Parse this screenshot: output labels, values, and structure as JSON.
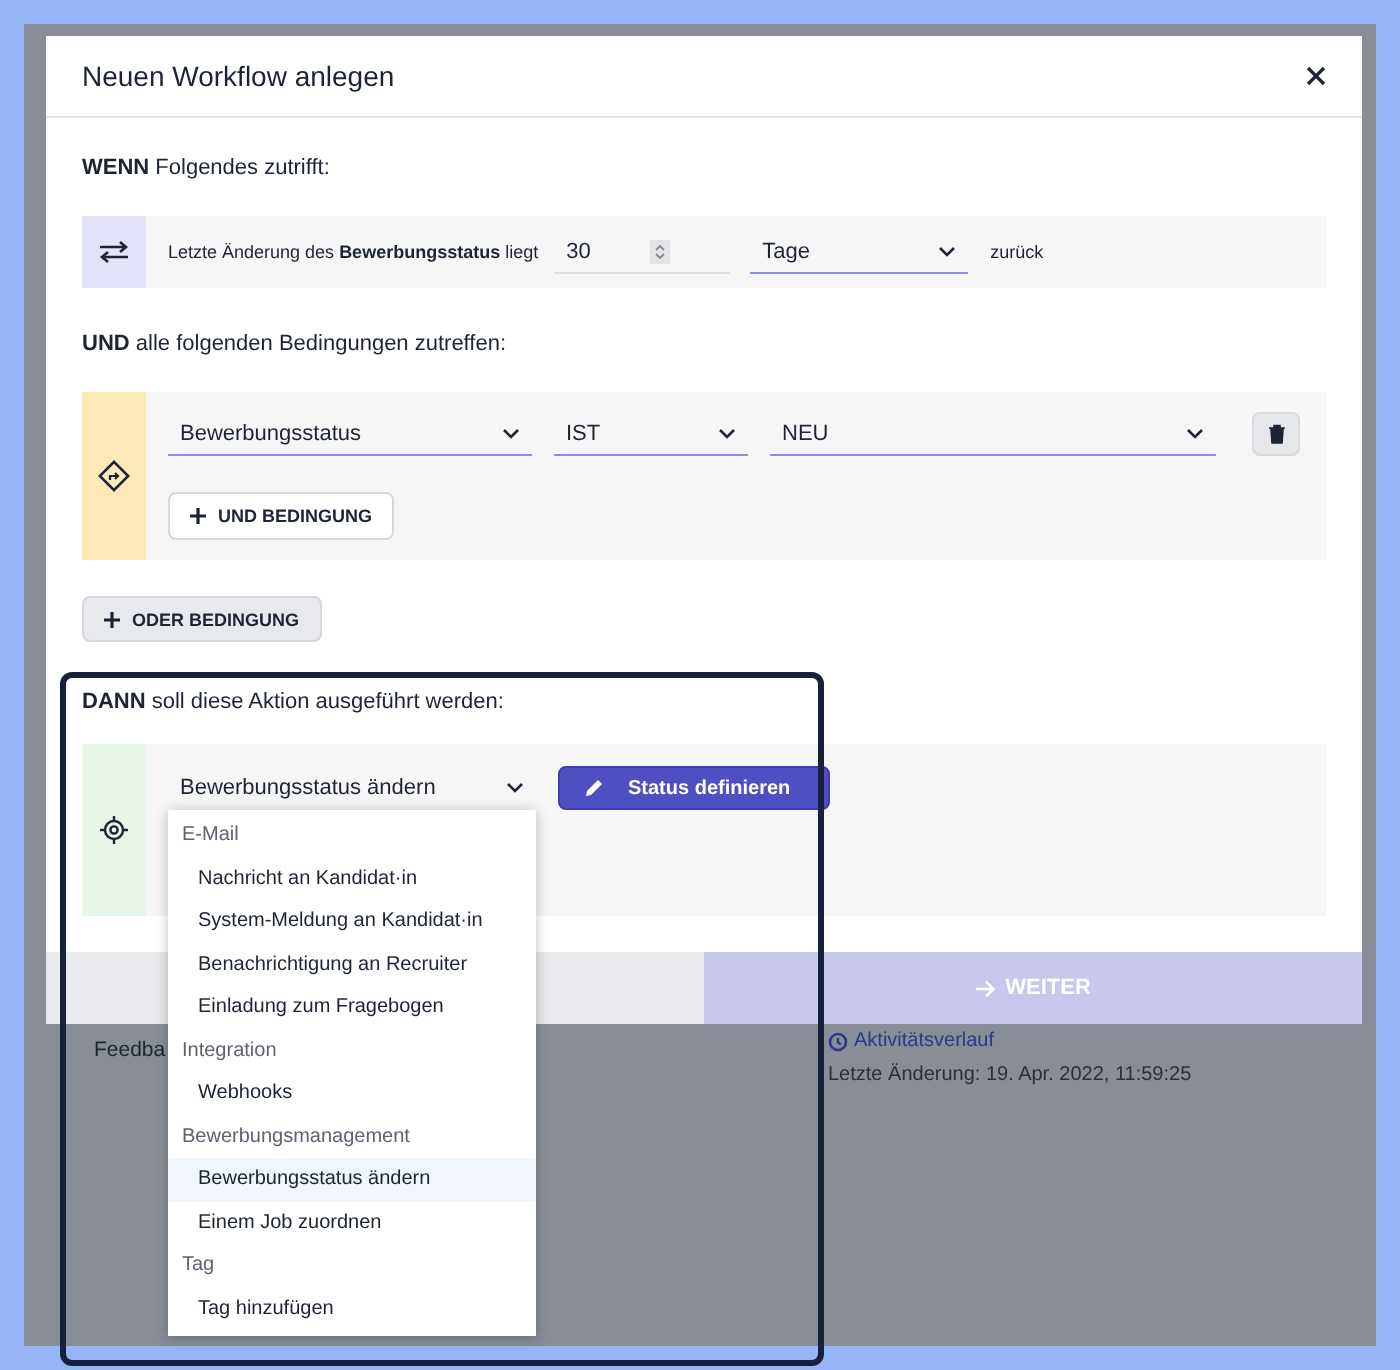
{
  "dialog": {
    "title": "Neuen Workflow anlegen"
  },
  "trigger": {
    "heading": "**WENN** Folgendes zutrifft:",
    "text": "Letzte Änderung des **Bewerbungsstatus** liegt",
    "amount": "30",
    "unit": "Tage",
    "suffix": "zurück"
  },
  "conditions": {
    "heading": "**UND** alle folgenden Bedingungen zutreffen:",
    "rows": [
      {
        "field": "Bewerbungsstatus",
        "operator": "IST",
        "value": "NEU"
      }
    ],
    "add_and": "UND BEDINGUNG"
  },
  "add_or": "ODER BEDINGUNG",
  "action": {
    "heading": "**DANN** soll diese Aktion ausgeführt werden:",
    "select": "Bewerbungsstatus ändern",
    "button": "Status definieren",
    "menu": [
      {
        "group": "E-Mail",
        "items": [
          {
            "label": "Nachricht an Kandidat·in",
            "selected": false
          },
          {
            "label": "System-Meldung an Kandidat·in",
            "selected": false
          },
          {
            "label": "Benachrichtigung an Recruiter",
            "selected": false
          },
          {
            "label": "Einladung zum Fragebogen",
            "selected": false
          }
        ]
      },
      {
        "group": "Integration",
        "items": [
          {
            "label": "Webhooks",
            "selected": false
          }
        ]
      },
      {
        "group": "Bewerbungsmanagement",
        "items": [
          {
            "label": "Bewerbungsstatus ändern",
            "selected": true
          },
          {
            "label": "Einem Job zuordnen",
            "selected": false
          }
        ]
      },
      {
        "group": "Tag",
        "items": [
          {
            "label": "Tag hinzufügen",
            "selected": false
          }
        ]
      }
    ]
  },
  "footer": {
    "next": "WEITER"
  },
  "background": {
    "feedback": "Feedba",
    "activity": "Aktivitätsverlauf",
    "last_change": "Letzte Änderung: 19. Apr. 2022, 11:59:25"
  }
}
